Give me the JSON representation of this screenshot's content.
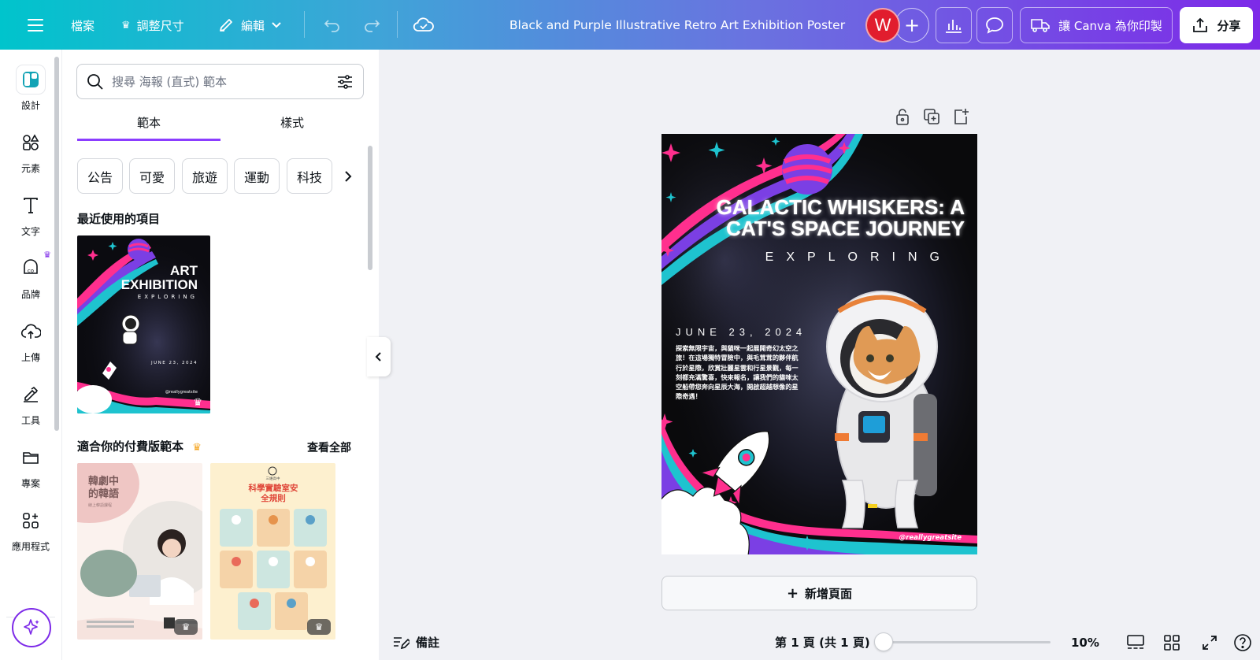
{
  "topbar": {
    "file_label": "檔案",
    "resize_label": "調整尺寸",
    "edit_label": "編輯",
    "doc_title": "Black and Purple Illustrative Retro Art Exhibition Poster",
    "avatar_letter": "W",
    "print_label": "讓 Canva 為你印製",
    "share_label": "分享"
  },
  "rail": {
    "items": [
      {
        "label": "設計",
        "icon": "design-icon"
      },
      {
        "label": "元素",
        "icon": "elements-icon"
      },
      {
        "label": "文字",
        "icon": "text-icon"
      },
      {
        "label": "品牌",
        "icon": "brand-icon"
      },
      {
        "label": "上傳",
        "icon": "upload-icon"
      },
      {
        "label": "工具",
        "icon": "tools-icon"
      },
      {
        "label": "專案",
        "icon": "projects-icon"
      },
      {
        "label": "應用程式",
        "icon": "apps-icon"
      }
    ]
  },
  "panel": {
    "search_placeholder": "搜尋 海報 (直式) 範本",
    "tabs": [
      "範本",
      "樣式"
    ],
    "chips": [
      "公告",
      "可愛",
      "旅遊",
      "運動",
      "科技"
    ],
    "recent_title": "最近使用的項目",
    "recent_thumb": {
      "title_line1": "ART",
      "title_line2": "EXHIBITION",
      "subtitle": "EXPLORING",
      "date": "JUNE 23, 2024",
      "site": "@reallygreatsite"
    },
    "premium_title": "適合你的付費版範本",
    "view_all": "查看全部",
    "premium_thumbs": [
      {
        "title": "韓劇中的韓語",
        "subtitle": "線上韓語課程"
      },
      {
        "title": "科學實驗室安全規則",
        "subtitle": "三維高中"
      }
    ]
  },
  "poster": {
    "title_line1": "GALACTIC WHISKERS: A",
    "title_line2": "CAT'S SPACE JOURNEY",
    "subtitle": "EXPLORING",
    "date": "JUNE 23, 2024",
    "body": "探索無限宇宙，與貓咪一起展開奇幻太空之旅！在這場獨特冒險中，與毛茸茸的夥伴航行於星際，欣賞壯麗星雲和行星景觀，每一刻都充滿驚喜，快來報名，讓我們的貓咪太空船帶您奔向星辰大海，開啟超越想像的星際奇遇！",
    "site": "@reallygreatsite"
  },
  "canvas": {
    "add_page_label": "新增頁面"
  },
  "bottom": {
    "notes_label": "備註",
    "page_info": "第 1 頁 (共 1 頁)",
    "zoom": "10%",
    "zoom_fraction": 0.02
  },
  "colors": {
    "accent": "#8b3dff",
    "pink": "#ff2f8e",
    "cyan": "#1ec3cf",
    "purple": "#7b3fe4"
  }
}
